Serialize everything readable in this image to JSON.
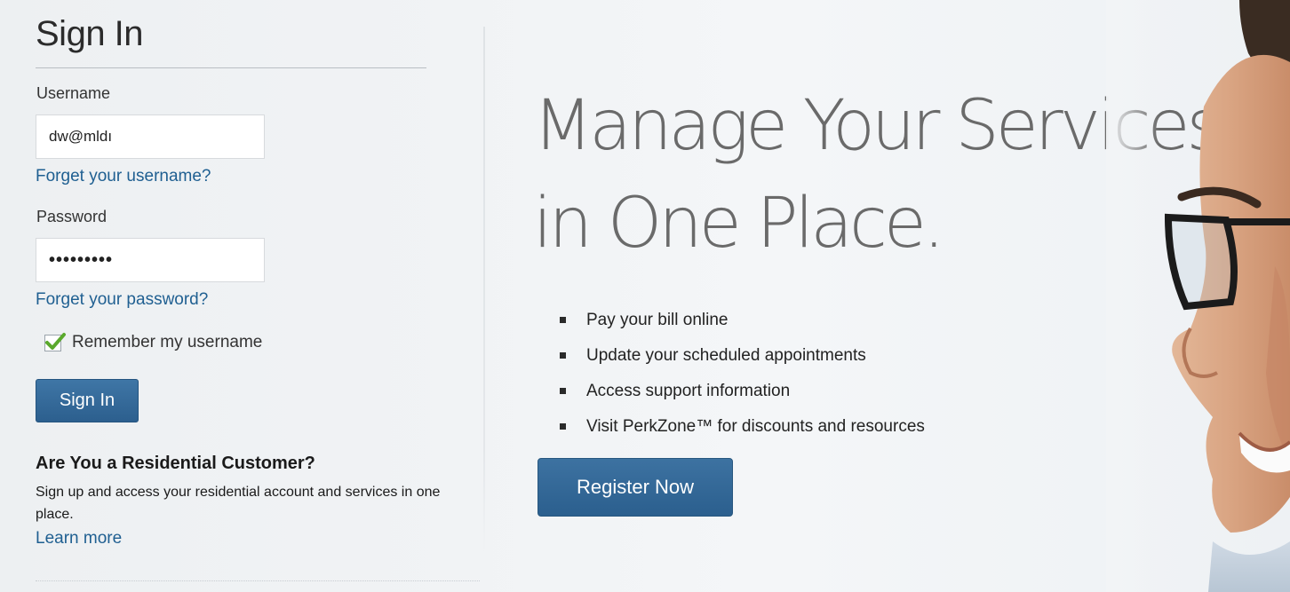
{
  "signin": {
    "title": "Sign In",
    "username_label": "Username",
    "username_value": "dw@mldı",
    "forgot_username": "Forget your username?",
    "password_label": "Password",
    "password_value": "•••••••••",
    "forgot_password": "Forget your password?",
    "remember_label": "Remember my username",
    "remember_checked": true,
    "submit_label": "Sign In"
  },
  "residential": {
    "heading": "Are You a Residential Customer?",
    "text": "Sign up and access your residential account and services in one place.",
    "link": "Learn more"
  },
  "hero": {
    "headline_line1": "Manage Your Services",
    "headline_line2": "in One Place.",
    "benefits": [
      "Pay your bill online",
      "Update your scheduled appointments",
      "Access support information",
      "Visit PerkZone™ for discounts and resources"
    ],
    "register_label": "Register Now"
  },
  "icons": {
    "checkbox": "checkmark-icon",
    "bullet": "square-bullet-icon"
  },
  "colors": {
    "accent_blue": "#2c5f8e",
    "link_blue": "#1f5f91",
    "check_green": "#5aa92c",
    "headline_gray": "#6a6a6a"
  }
}
